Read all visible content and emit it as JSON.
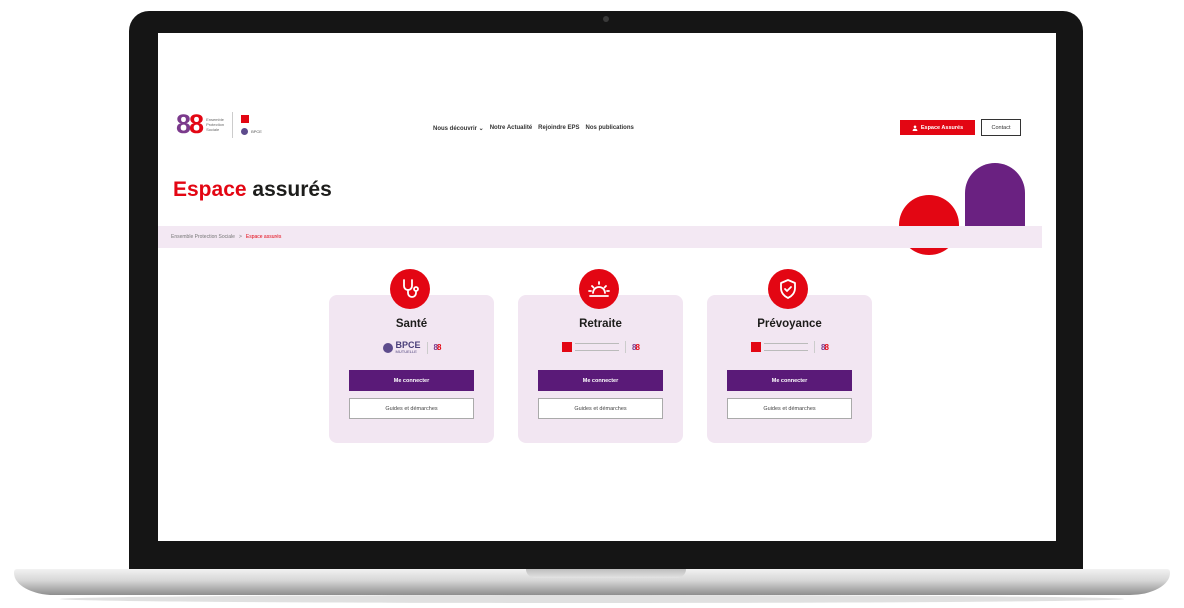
{
  "header": {
    "logo_mark_left": "8",
    "logo_mark_right": "8",
    "logo_lines": [
      "Ensemble",
      "Protection",
      "Sociale"
    ],
    "partners": [
      "",
      "BPCE"
    ],
    "nav": [
      "Nous découvrir ⌄",
      "Notre Actualité",
      "Rejoindre EPS",
      "Nos publications"
    ],
    "espace_button": "Espace Assurés",
    "contact_button": "Contact"
  },
  "page": {
    "title_red": "Espace",
    "title_rest": " assurés"
  },
  "breadcrumb": {
    "home": "Ensemble Protection Sociale",
    "separator": ">",
    "current": "Espace assurés"
  },
  "cards": [
    {
      "title": "Santé",
      "icon": "stethoscope-icon",
      "logo_name": "BPCE",
      "logo_sub": "MUTUELLE",
      "primary": "Me connecter",
      "secondary": "Guides et démarches"
    },
    {
      "title": "Retraite",
      "icon": "sunrise-icon",
      "primary": "Me connecter",
      "secondary": "Guides et démarches"
    },
    {
      "title": "Prévoyance",
      "icon": "shield-check-icon",
      "primary": "Me connecter",
      "secondary": "Guides et démarches"
    }
  ],
  "colors": {
    "brand_red": "#e30613",
    "brand_purple": "#6a2181",
    "button_purple": "#5a1a78",
    "card_bg": "#f2e6f2"
  }
}
